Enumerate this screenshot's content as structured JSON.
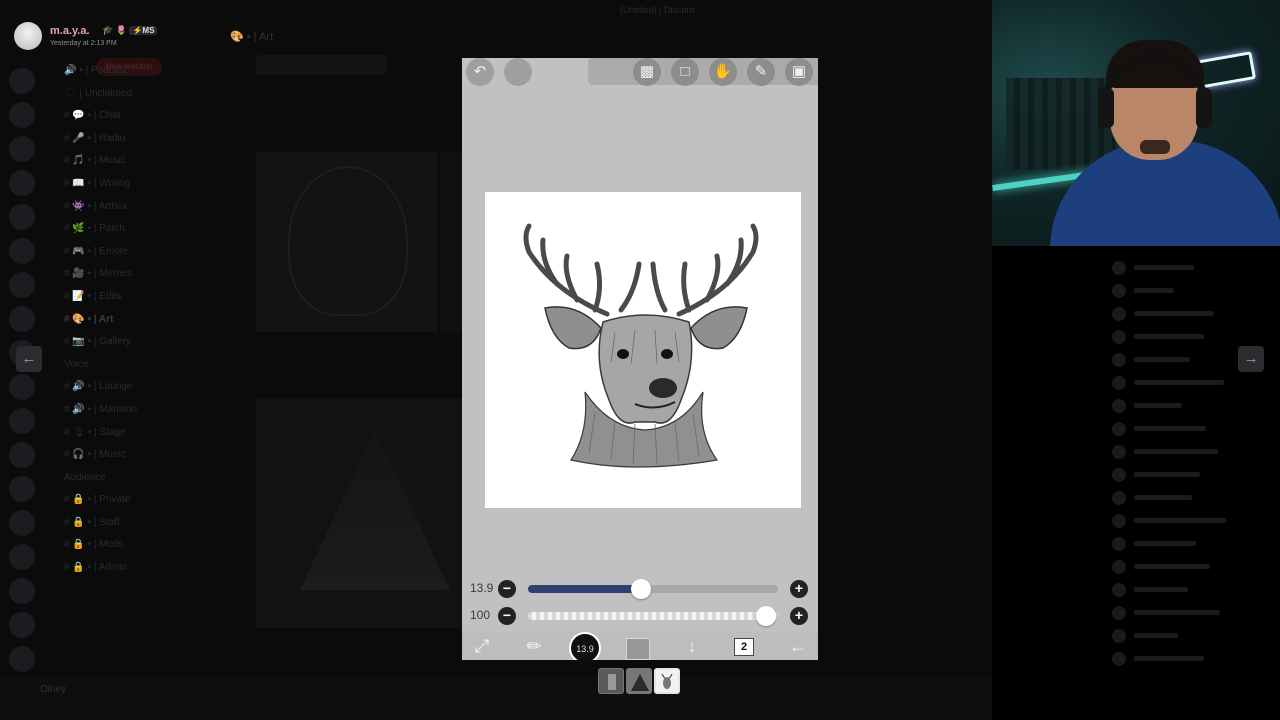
{
  "window_title": "(Untitled) | Discord",
  "viewer_user": {
    "name": "m.a.y.a.",
    "badges": "🎓 🌷",
    "tag": "⚡MS",
    "timestamp": "Yesterday at 2:13 PM"
  },
  "background": {
    "channel_header": "🎨 • | Art",
    "new_reactions_pill": "New reaction",
    "channels": [
      "🔊 • | Podcast",
      "🗨 | Unclaimed",
      "# 💬 • | Chat",
      "# 🎤 • | Radio",
      "# 🎵 • | Music",
      "# 📖 • | Writing",
      "# 👾 • | Artbox",
      "# 🌿 • | Patch",
      "# 🎮 • | Emote",
      "# 🎥 • | Memes",
      "# 📝 • | Edits",
      "# 🎨 • | Art",
      "# 📷 • | Gallery",
      "Voice",
      "# 🔊 • | Lounge",
      "# 🔊 • | Mansion",
      "# 🎙 • | Stage",
      "# 🎧 • | Music",
      "Audience",
      "# 🔒 • | Private",
      "# 🔒 • | Staff",
      "# 🔒 • | Mods",
      "# 🔒 • | Admin"
    ],
    "footer_user": "Olney"
  },
  "app": {
    "brush_size_label": "13.9",
    "brush_size_percent": 45,
    "opacity_label": "100",
    "opacity_percent": 100,
    "brush_circle_label": "13.9",
    "layer_count": "2",
    "canvas_subject": "deer-sketch"
  },
  "thumbnails": [
    "layer-thumb-1",
    "layer-thumb-2",
    "layer-thumb-3"
  ],
  "colors": {
    "slider_fill": "#2e4272",
    "app_bg": "#c1c1c1",
    "username": "#e8a5ac",
    "webcam_neon": "#58f0e0"
  }
}
